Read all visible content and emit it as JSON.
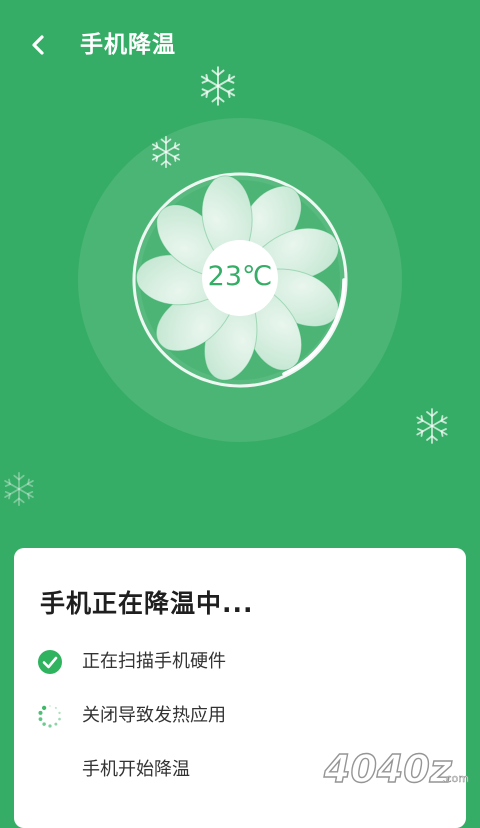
{
  "header": {
    "title": "手机降温",
    "back_icon": "chevron-left-icon"
  },
  "fan": {
    "temperature": "23℃",
    "icon": "fan-icon"
  },
  "decorations": {
    "snowflake_icon": "snowflake-icon"
  },
  "card": {
    "title": "手机正在降温中...",
    "steps": [
      {
        "label": "正在扫描手机硬件",
        "status": "done",
        "icon": "check-circle-icon"
      },
      {
        "label": "关闭导致发热应用",
        "status": "in-progress",
        "icon": "loading-spinner-icon"
      },
      {
        "label": "手机开始降温",
        "status": "pending",
        "icon": ""
      }
    ]
  },
  "watermark": {
    "text": "4040z",
    "suffix": ".com"
  },
  "colors": {
    "background": "#36ad66",
    "accent": "#36ad66",
    "card": "#ffffff",
    "text": "#1f1f1f"
  }
}
